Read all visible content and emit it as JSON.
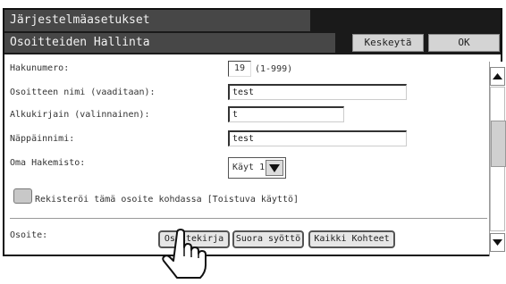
{
  "header": {
    "title": "Järjestelmäasetukset",
    "subtitle": "Osoitteiden Hallinta",
    "cancel_label": "Keskeytä",
    "ok_label": "OK"
  },
  "form": {
    "search_number_label": "Hakunumero:",
    "search_number_value": "19",
    "search_number_range": "(1-999)",
    "address_name_label": "Osoitteen nimi (vaaditaan):",
    "address_name_value": "test",
    "initial_label": "Alkukirjain (valinnainen):",
    "initial_value": "t",
    "key_name_label": "Näppäinnimi:",
    "key_name_value": "test",
    "custom_index_label": "Oma Hakemisto:",
    "custom_index_value": "Käyt 1",
    "register_checkbox_label": "Rekisteröi tämä osoite kohdassa [Toistuva käyttö]",
    "address_label": "Osoite:"
  },
  "address_buttons": {
    "address_book": "Osoitekirja",
    "direct_entry": "Suora syöttö",
    "all_destinations": "Kaikki Kohteet"
  },
  "icons": {
    "select_arrow": "triangle-down-icon",
    "scroll_up": "triangle-up-icon",
    "scroll_down": "triangle-down-icon",
    "pointer": "hand-pointer-icon"
  },
  "colors": {
    "title_bar": "#474747",
    "title_bg": "#1a1a1a",
    "button_face": "#d4d4d4"
  }
}
